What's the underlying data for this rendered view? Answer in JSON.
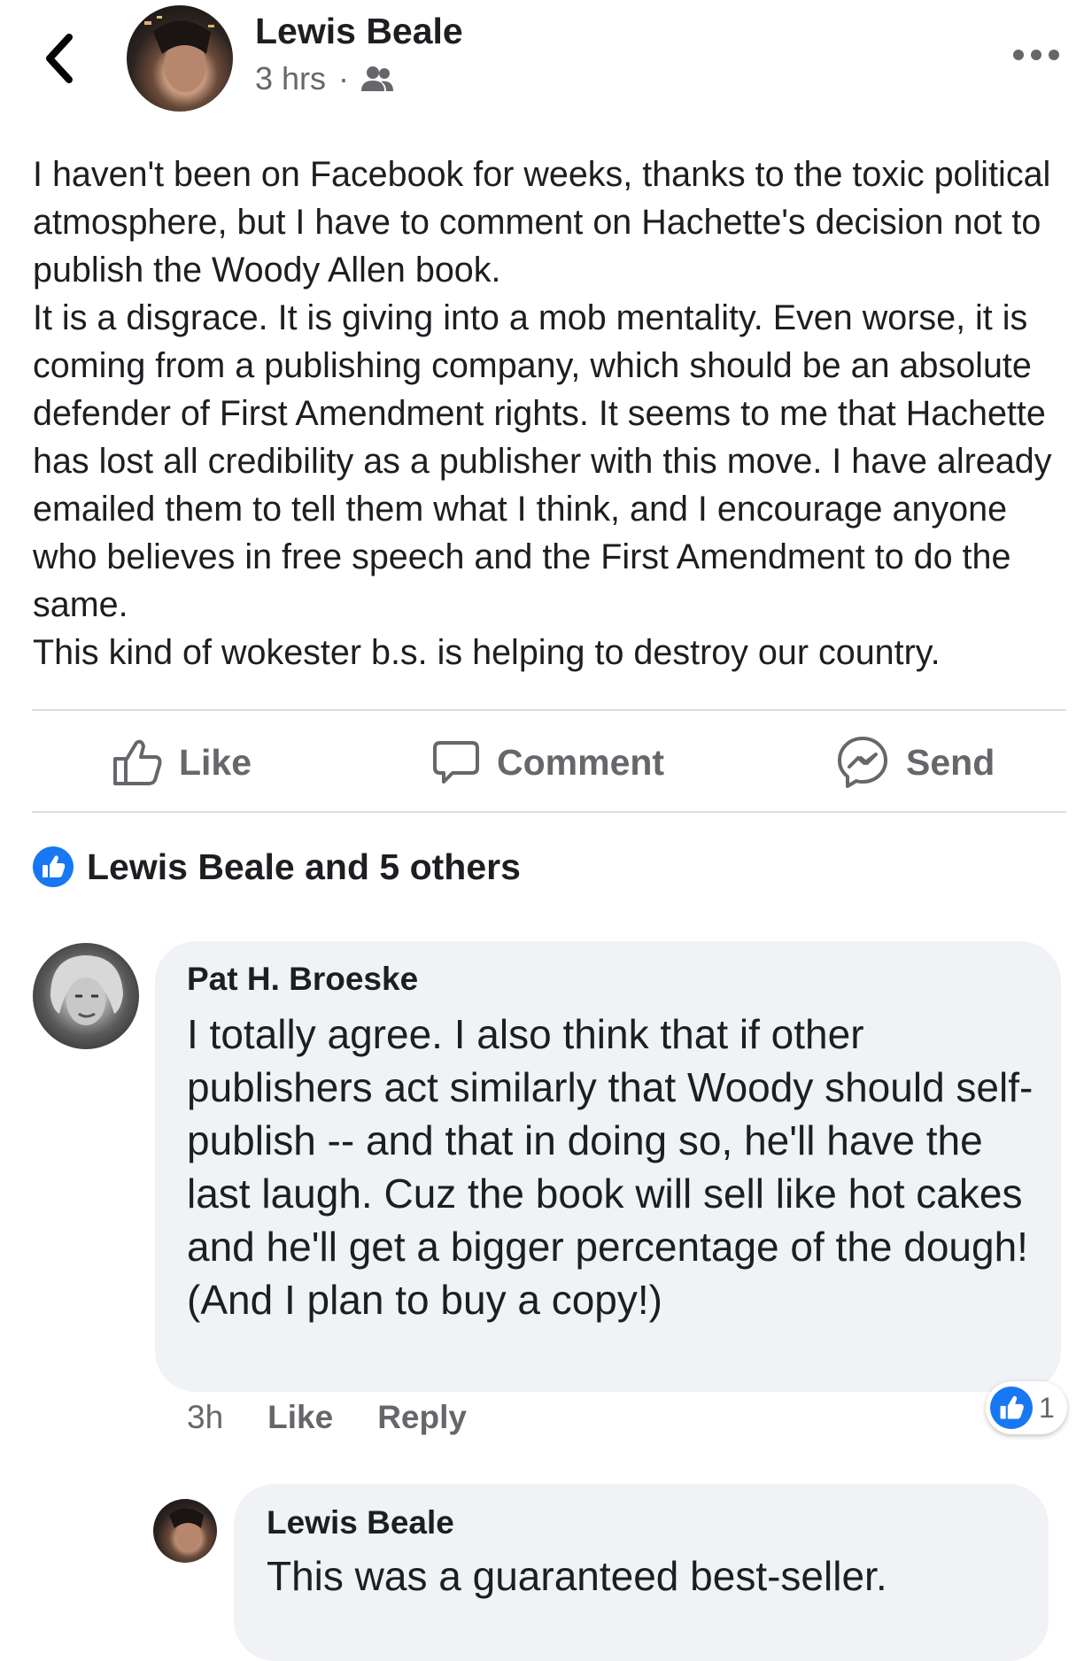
{
  "header": {
    "back_icon": "chevron-left-icon",
    "author_name": "Lewis Beale",
    "timestamp": "3 hrs",
    "separator": "·",
    "audience_icon": "friends-icon",
    "more_icon": "more-dots-icon"
  },
  "post": {
    "paragraphs": [
      "I haven't been on Facebook for weeks, thanks to the toxic political atmosphere, but I have to comment on Hachette's decision not to publish the Woody Allen book.",
      "It is a disgrace. It is giving into a mob mentality. Even worse, it is coming from a publishing company, which should be an absolute defender of First Amendment rights. It seems to me that Hachette has lost all credibility as a publisher with this move. I have already emailed them to tell them what I think, and I encourage anyone who believes in free speech and the First Amendment to do the same.",
      "This kind of wokester b.s. is helping to destroy our country."
    ]
  },
  "actions": {
    "like": "Like",
    "comment": "Comment",
    "send": "Send"
  },
  "reactions": {
    "icon": "like-reaction-icon",
    "text": "Lewis Beale and 5 others"
  },
  "comment": {
    "author": "Pat H. Broeske",
    "text": "I totally agree. I also think that if other publishers act similarly that Woody should self-publish -- and that in doing so, he'll have the last laugh. Cuz the book will sell like hot cakes and he'll get a bigger percentage of the dough! (And I plan to buy a copy!)",
    "time": "3h",
    "like_label": "Like",
    "reply_label": "Reply",
    "like_count": "1"
  },
  "reply": {
    "author": "Lewis Beale",
    "text": "This was a guaranteed best-seller."
  },
  "colors": {
    "facebook_blue": "#1877f2",
    "secondary_text": "#65676b",
    "bubble_bg": "#f0f2f5"
  }
}
